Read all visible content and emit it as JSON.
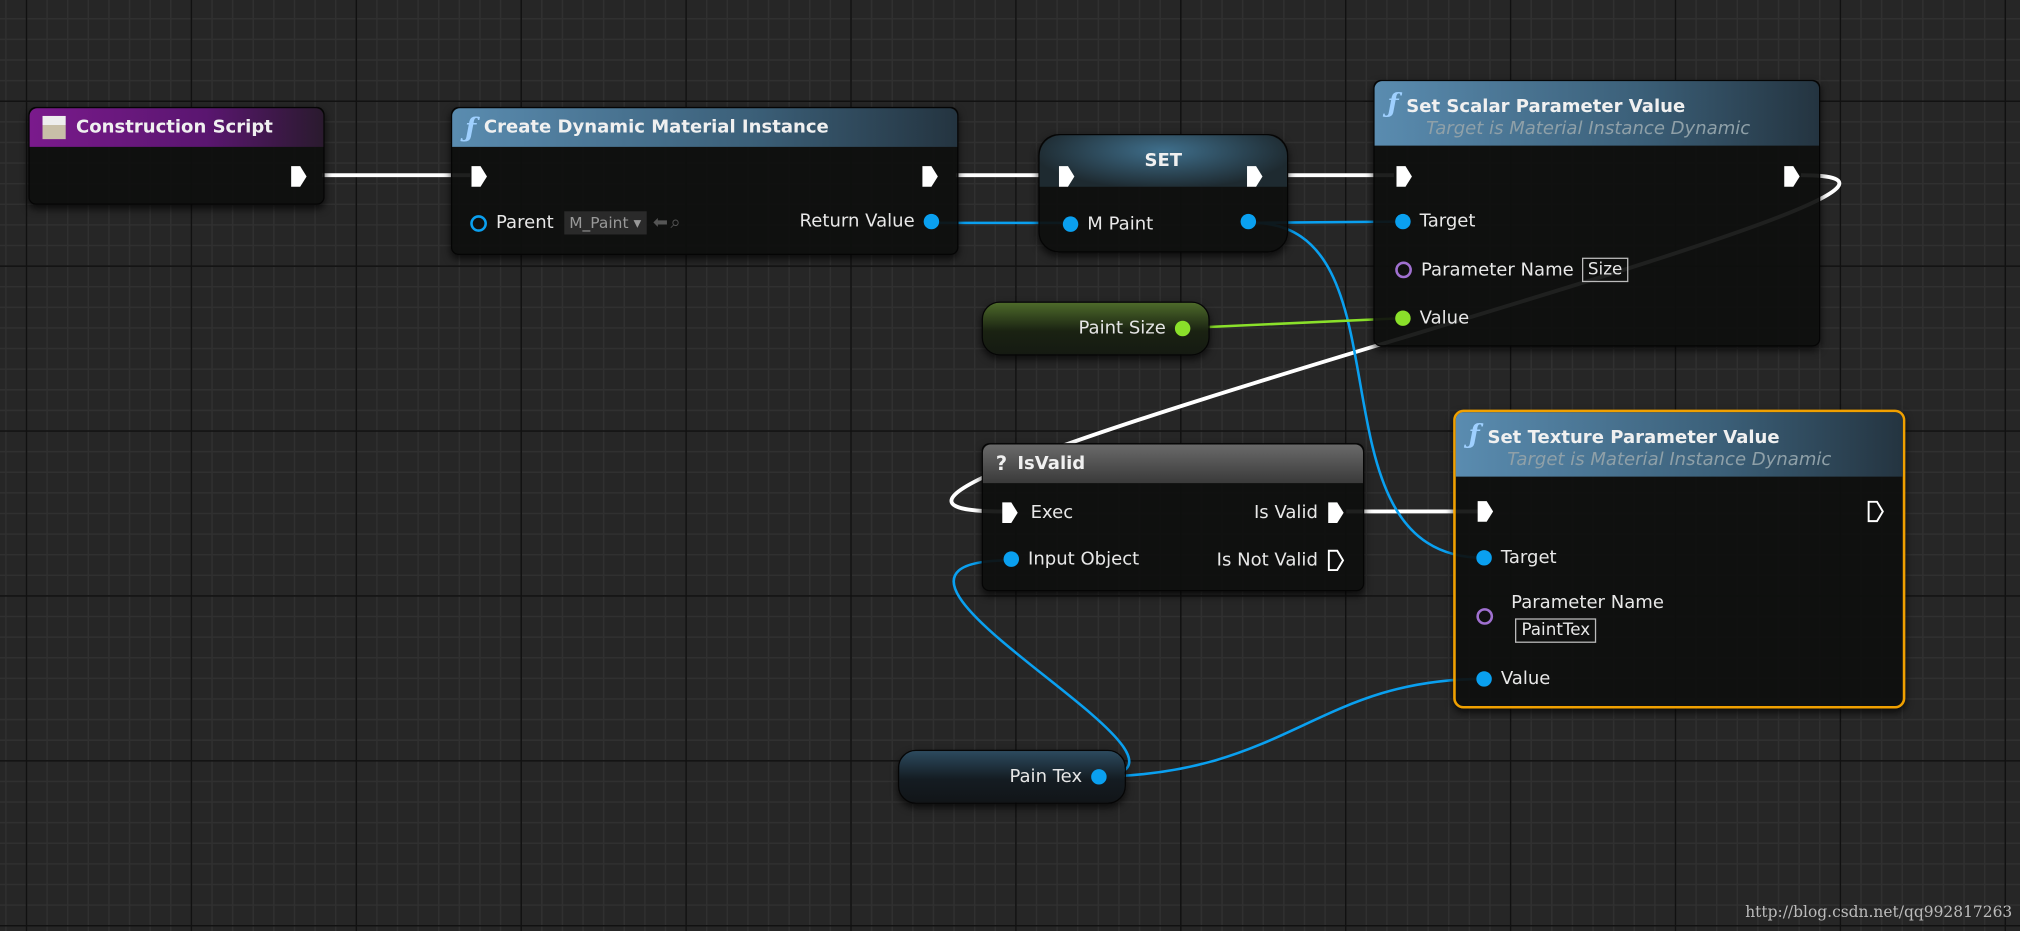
{
  "nodes": {
    "construction_script": {
      "title": "Construction Script",
      "icon": "construction-script-icon"
    },
    "create_dmi": {
      "title": "Create Dynamic Material Instance",
      "parent_label": "Parent",
      "parent_value": "M_Paint",
      "return_label": "Return Value"
    },
    "set": {
      "title": "SET",
      "var_label": "M Paint"
    },
    "set_scalar": {
      "title": "Set Scalar Parameter Value",
      "subtitle": "Target is Material Instance Dynamic",
      "target_label": "Target",
      "param_label": "Parameter Name",
      "param_value": "Size",
      "value_label": "Value"
    },
    "paint_size": {
      "label": "Paint Size"
    },
    "is_valid": {
      "title": "IsValid",
      "exec_label": "Exec",
      "input_label": "Input Object",
      "valid_label": "Is Valid",
      "not_valid_label": "Is Not Valid"
    },
    "set_texture": {
      "title": "Set Texture Parameter Value",
      "subtitle": "Target is Material Instance Dynamic",
      "target_label": "Target",
      "param_label": "Parameter Name",
      "param_value": "PaintTex",
      "value_label": "Value"
    },
    "pain_tex": {
      "label": "Pain Tex"
    }
  },
  "colors": {
    "object_pin": "#0aa0f0",
    "float_pin": "#8ae02a",
    "name_pin": "#a070d0",
    "exec": "#ffffff",
    "selected_border": "#f0a000"
  },
  "watermark": "http://blog.csdn.net/qq992817263"
}
